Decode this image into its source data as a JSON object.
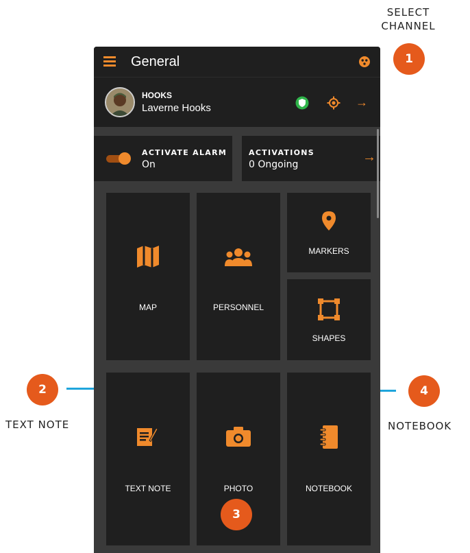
{
  "annotations": {
    "select_channel_line1": "SELECT",
    "select_channel_line2": "CHANNEL",
    "text_note": "TEXT NOTE",
    "notebook": "NOTEBOOK",
    "badges": [
      "1",
      "2",
      "3",
      "4"
    ]
  },
  "app": {
    "title": "General",
    "icons": {
      "menu": "hamburger-menu-icon",
      "channel": "channel-select-icon"
    }
  },
  "user": {
    "handle": "HOOKS",
    "name": "Laverne Hooks",
    "icons": {
      "status": "shield-status-icon",
      "locate": "locate-icon",
      "arrow": "arrow-right-icon"
    }
  },
  "alarm": {
    "label": "ACTIVATE ALARM",
    "value": "On",
    "toggle_on": true
  },
  "activations": {
    "label": "ACTIVATIONS",
    "value": "0 Ongoing"
  },
  "tiles": {
    "map": "MAP",
    "personnel": "PERSONNEL",
    "markers": "MARKERS",
    "shapes": "SHAPES",
    "text_note": "TEXT NOTE",
    "photo": "PHOTO",
    "notebook": "NOTEBOOK"
  },
  "colors": {
    "accent": "#f08a2c",
    "badge": "#e55a1c",
    "leader_line": "#1fa5dc",
    "tile_bg": "#1f1f1f",
    "panel_bg": "#3a3a3a",
    "status_green": "#2fb44a"
  }
}
